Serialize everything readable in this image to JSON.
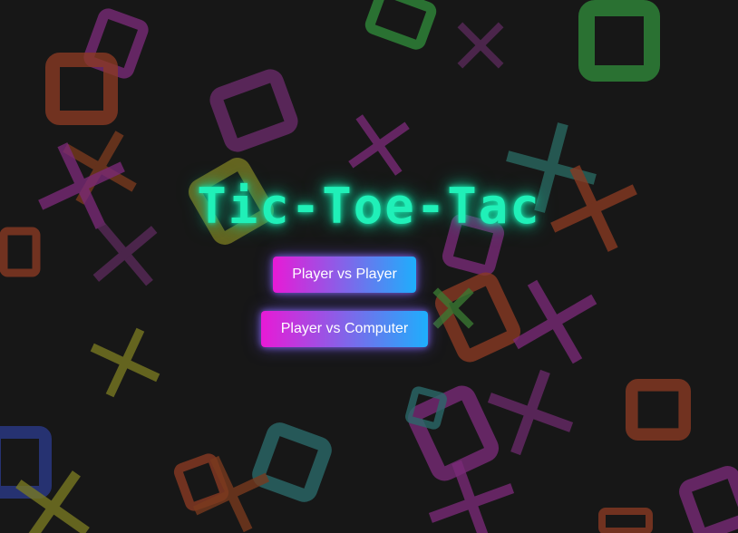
{
  "app": {
    "title": "Tic-Toe-Tac"
  },
  "menu": {
    "pvp_label": "Player vs Player",
    "pvc_label": "Player vs Computer"
  },
  "colors": {
    "background": "#171717",
    "title_glow": "#20f0b8",
    "button_gradient_start": "#e81ad6",
    "button_gradient_end": "#1eaefc"
  },
  "background_pieces": {
    "x_marks": [
      {
        "color": "#7a3a1e"
      },
      {
        "color": "#7a2a78"
      },
      {
        "color": "#7a2a78"
      },
      {
        "color": "#2a6a62"
      },
      {
        "color": "#8a3a22"
      },
      {
        "color": "#5a2a5a"
      },
      {
        "color": "#7a7a22"
      },
      {
        "color": "#7a2a78"
      },
      {
        "color": "#6a2a6a"
      },
      {
        "color": "#3a7a32"
      },
      {
        "color": "#7a7a22"
      },
      {
        "color": "#7a2a78"
      },
      {
        "color": "#7a3a1e"
      },
      {
        "color": "#5a2a5a"
      }
    ],
    "o_marks": [
      {
        "color": "#7a2a78"
      },
      {
        "color": "#8a3a22"
      },
      {
        "color": "#2f8a3a"
      },
      {
        "color": "#2f8a3a"
      },
      {
        "color": "#6a2a6a"
      },
      {
        "color": "#7a7a22"
      },
      {
        "color": "#7a2a78"
      },
      {
        "color": "#8a3a22"
      },
      {
        "color": "#7a2a78"
      },
      {
        "color": "#2a6a6a"
      },
      {
        "color": "#8a3a22"
      },
      {
        "color": "#2a3a8a"
      },
      {
        "color": "#2a6a6a"
      },
      {
        "color": "#8a3a22"
      },
      {
        "color": "#7a2a78"
      },
      {
        "color": "#8a3a22"
      },
      {
        "color": "#8a3a22"
      }
    ]
  }
}
